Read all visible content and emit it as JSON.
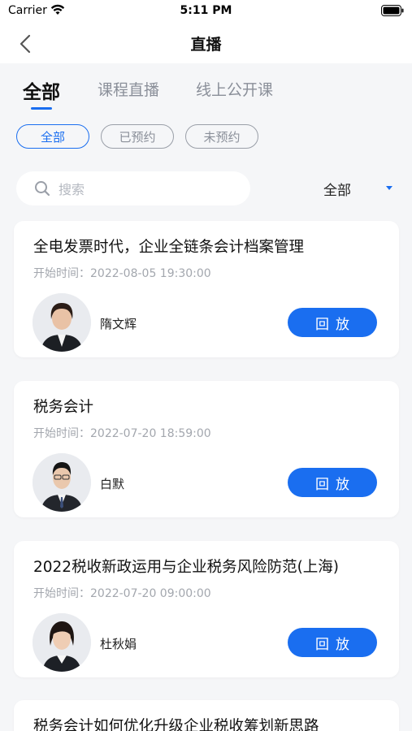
{
  "status_bar": {
    "carrier": "Carrier",
    "time": "5:11 PM"
  },
  "nav": {
    "title": "直播"
  },
  "tabs": [
    {
      "label": "全部",
      "active": true
    },
    {
      "label": "课程直播",
      "active": false
    },
    {
      "label": "线上公开课",
      "active": false
    }
  ],
  "chips": [
    {
      "label": "全部",
      "active": true
    },
    {
      "label": "已预约",
      "active": false
    },
    {
      "label": "未预约",
      "active": false
    }
  ],
  "search": {
    "placeholder": "搜索"
  },
  "filter": {
    "selected": "全部"
  },
  "courses": [
    {
      "title": "全电发票时代，企业全链条会计档案管理",
      "time": "开始时间：2022-08-05 19:30:00",
      "speaker": "隋文辉",
      "action": "回放"
    },
    {
      "title": "税务会计",
      "time": "开始时间：2022-07-20 18:59:00",
      "speaker": "白默",
      "action": "回放"
    },
    {
      "title": "2022税收新政运用与企业税务风险防范(上海)",
      "time": "开始时间：2022-07-20 09:00:00",
      "speaker": "杜秋娟",
      "action": "回放"
    },
    {
      "title": "税务会计如何优化升级企业税收筹划新思路"
    }
  ],
  "colors": {
    "accent": "#1a6ef0",
    "background": "#f5f6f8"
  }
}
